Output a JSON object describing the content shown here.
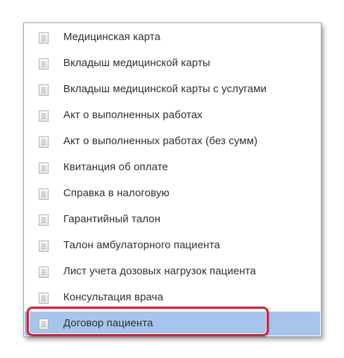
{
  "menu": {
    "items": [
      {
        "label": "Медицинская карта",
        "icon": "document-icon"
      },
      {
        "label": "Вкладыш медицинской карты",
        "icon": "document-icon"
      },
      {
        "label": "Вкладыш медицинской карты с услугами",
        "icon": "document-icon"
      },
      {
        "label": "Акт о выполненных работах",
        "icon": "document-icon"
      },
      {
        "label": "Акт о выполненных работах (без сумм)",
        "icon": "document-icon"
      },
      {
        "label": "Квитанция об оплате",
        "icon": "document-icon"
      },
      {
        "label": "Справка в налоговую",
        "icon": "document-icon"
      },
      {
        "label": "Гарантийный талон",
        "icon": "document-icon"
      },
      {
        "label": "Талон амбулаторного пациента",
        "icon": "document-icon"
      },
      {
        "label": "Лист учета дозовых нагрузок пациента",
        "icon": "document-icon"
      },
      {
        "label": "Консультация врача",
        "icon": "document-icon"
      },
      {
        "label": "Договор пациента",
        "icon": "document-icon",
        "selected": true
      }
    ]
  },
  "colors": {
    "selection": "#a7c5ec",
    "highlight_ring": "#d61f2c",
    "text": "#2f2f2f"
  }
}
